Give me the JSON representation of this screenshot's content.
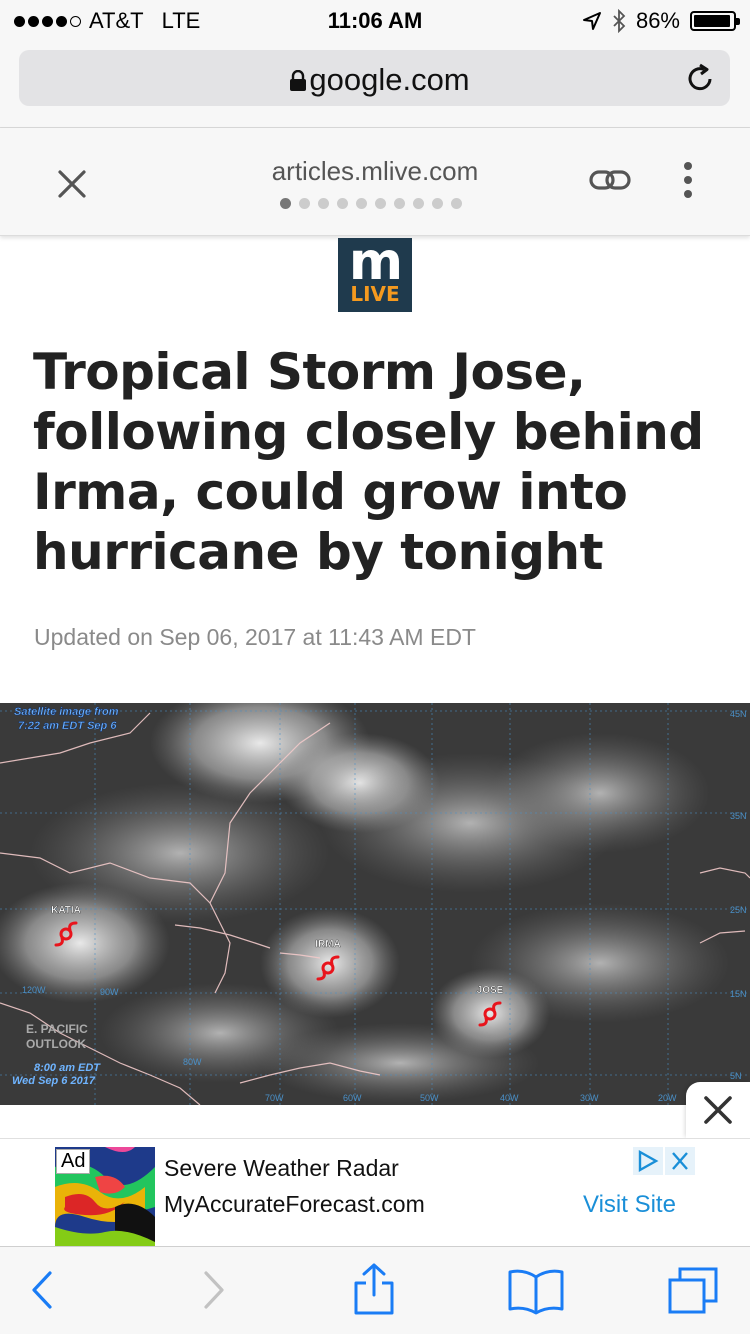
{
  "status_bar": {
    "carrier": "AT&T",
    "network": "LTE",
    "time": "11:06 AM",
    "battery": "86%",
    "battery_level": 0.86,
    "signal_bars": 4
  },
  "browser": {
    "url": "google.com"
  },
  "amp_viewer": {
    "domain": "articles.mlive.com",
    "page_dots": 10,
    "active_dot": 0
  },
  "article": {
    "logo_top": "m",
    "logo_bottom": "LIVE",
    "headline": "Tropical Storm Jose, following closely behind Irma, could grow into hurricane by tonight",
    "updated": "Updated on Sep 06, 2017 at 11:43 AM EDT"
  },
  "satellite_image": {
    "caption_top": "Satellite image from 7:22 am EDT Sep 6",
    "caption_top_line1": "Satellite image from",
    "caption_top_line2": "7:22 am EDT Sep 6",
    "outlook_line1": "E. PACIFIC",
    "outlook_line2": "OUTLOOK",
    "outlook_time_line1": "8:00 am EDT",
    "outlook_time_line2": "Wed Sep 6 2017",
    "storms": [
      "KATIA",
      "IRMA",
      "JOSE"
    ],
    "lat_labels": [
      "45N",
      "35N",
      "25N",
      "15N",
      "5N"
    ],
    "lon_labels": [
      "90W",
      "80W",
      "70W",
      "60W",
      "50W",
      "40W",
      "30W",
      "20W",
      "120W"
    ],
    "storm_color": "#e8141c"
  },
  "ad": {
    "label": "Ad",
    "title": "Severe Weather Radar",
    "site": "MyAccurateForecast.com",
    "cta": "Visit Site",
    "cta_color": "#1a8fd8"
  }
}
